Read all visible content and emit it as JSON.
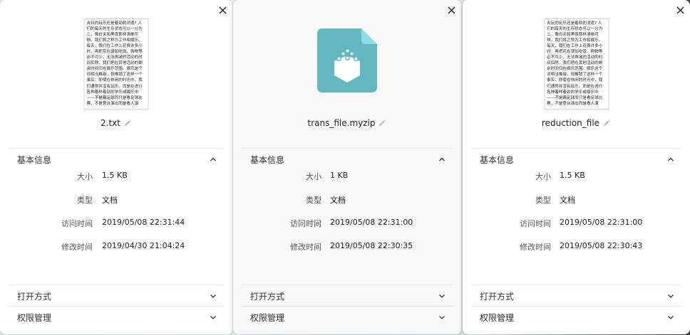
{
  "colors": {
    "zip_body": "#63b8c0",
    "zip_fold": "#8fdde4",
    "accent": "#2ca7f8"
  },
  "labels": {
    "basic_info": "基本信息",
    "size": "大小",
    "type": "类型",
    "access_time": "访问时间",
    "modify_time": "修改时间",
    "open_with": "打开方式",
    "permissions": "权限管理"
  },
  "preview_text": "去玩的玩乐还是着劲的消遣? 人们的每天的生存状态可以一分为二，像白天和黑夜那样清晰可辨。我们将之称为工作和娱乐。每天，我们在工作上花费许多小时，再把花在谋如吃饭、购物等必不可少。无法再减的活动的时间扣除，我们把在其他活动的剩余时间归在娱乐范围。娱乐这个词相当推敲。但推销了这样一个事实：即使在休闲的时光中，我们通常并没有玩乐。而是在进行各种着样着劲的学乐或娱乐中——不是踢足球而只是看足球比赛，不是登台演出而是看人演",
  "panels": [
    {
      "preview": "text",
      "filename": "2.txt",
      "size": "1.5 KB",
      "type": "文档",
      "access_time": "2019/05/08 22:31:44",
      "modify_time": "2019/04/30 21:04:24"
    },
    {
      "preview": "zip",
      "filename": "trans_file.myzip",
      "size": "1 KB",
      "type": "文档",
      "access_time": "2019/05/08 22:31:00",
      "modify_time": "2019/05/08 22:30:35"
    },
    {
      "preview": "text",
      "filename": "reduction_file",
      "size": "1.5 KB",
      "type": "文档",
      "access_time": "2019/05/08 22:31:00",
      "modify_time": "2019/05/08 22:30:43"
    }
  ]
}
